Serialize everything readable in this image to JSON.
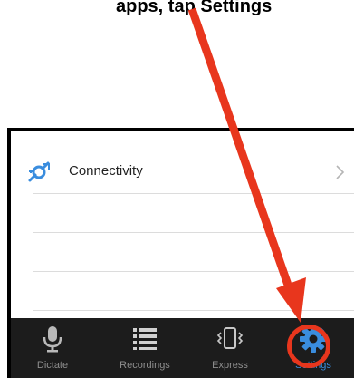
{
  "caption": {
    "text": "apps, tap Settings"
  },
  "settings_list": {
    "items": [
      {
        "label": "Connectivity",
        "icon": "connectivity-icon"
      }
    ]
  },
  "tabbar": {
    "tabs": [
      {
        "label": "Dictate",
        "icon": "microphone-icon",
        "active": false
      },
      {
        "label": "Recordings",
        "icon": "list-icon",
        "active": false
      },
      {
        "label": "Express",
        "icon": "phone-vibrate-icon",
        "active": false
      },
      {
        "label": "Settings",
        "icon": "gear-icon",
        "active": true
      }
    ]
  },
  "colors": {
    "accent": "#3a8dde",
    "annotation": "#e8361d",
    "tabbar_bg": "#1c1c1c"
  }
}
